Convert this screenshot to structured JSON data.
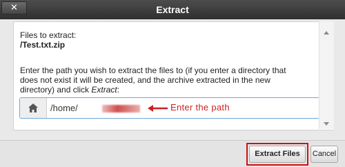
{
  "dialog": {
    "title": "Extract",
    "close_label": "✕"
  },
  "content": {
    "files_label": "Files to extract:",
    "file_name": "/Test.txt.zip",
    "instruction_line1": "Enter the path you wish to extract the files to (if you enter a directory that",
    "instruction_line2": "does not exist it will be created, and the archive extracted in the new",
    "instruction_line3_prefix": "directory) and click ",
    "instruction_line3_emph": "Extract",
    "instruction_line3_suffix": ":",
    "path_value": "/home/",
    "home_icon": "home-icon"
  },
  "annotation": {
    "text": "Enter the path",
    "color": "#cc1f1f"
  },
  "footer": {
    "extract_label": "Extract Files",
    "cancel_label": "Cancel",
    "highlight_color": "#cc1111"
  }
}
